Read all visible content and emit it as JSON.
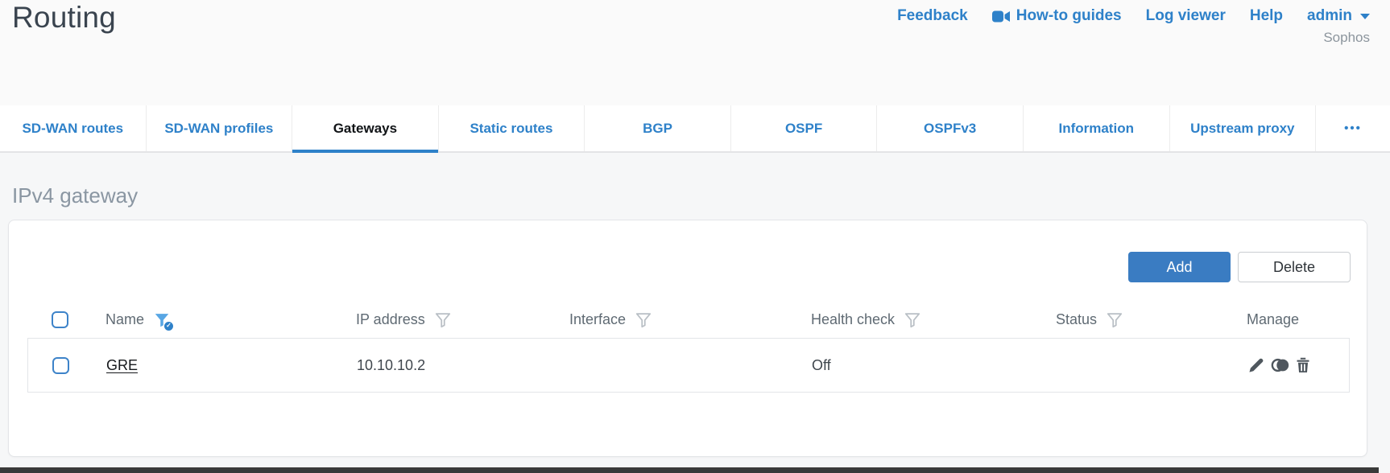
{
  "page": {
    "title": "Routing",
    "brand": "Sophos"
  },
  "top_nav": {
    "feedback": "Feedback",
    "how_to_guides": "How-to guides",
    "log_viewer": "Log viewer",
    "help": "Help",
    "user": "admin"
  },
  "tabs": [
    {
      "label": "SD-WAN routes",
      "active": false
    },
    {
      "label": "SD-WAN profiles",
      "active": false
    },
    {
      "label": "Gateways",
      "active": true
    },
    {
      "label": "Static routes",
      "active": false
    },
    {
      "label": "BGP",
      "active": false
    },
    {
      "label": "OSPF",
      "active": false
    },
    {
      "label": "OSPFv3",
      "active": false
    },
    {
      "label": "Information",
      "active": false
    },
    {
      "label": "Upstream proxy",
      "active": false
    },
    {
      "label": "•••",
      "active": false
    }
  ],
  "section": {
    "heading": "IPv4 gateway"
  },
  "toolbar": {
    "add_label": "Add",
    "delete_label": "Delete"
  },
  "table": {
    "columns": [
      {
        "label": "Name",
        "filter": "active"
      },
      {
        "label": "IP address",
        "filter": "inactive"
      },
      {
        "label": "Interface",
        "filter": "inactive"
      },
      {
        "label": "Health check",
        "filter": "inactive"
      },
      {
        "label": "Status",
        "filter": "inactive"
      },
      {
        "label": "Manage",
        "filter": "none"
      }
    ],
    "rows": [
      {
        "name": "GRE",
        "ip_address": "10.10.10.2",
        "interface": "",
        "health_check": "Off",
        "status_color": "#86c643",
        "actions": [
          "edit",
          "clone",
          "delete"
        ]
      }
    ]
  },
  "colors": {
    "accent_blue": "#2e81c9",
    "add_button_blue": "#3a7cc2",
    "status_green": "#86c643"
  }
}
